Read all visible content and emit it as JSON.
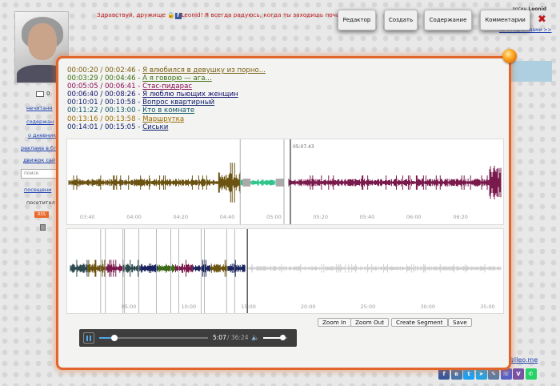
{
  "colors": {
    "accent": "#e1662b",
    "link": "#1a3fb0",
    "greeting": "#c01818"
  },
  "page": {
    "greeting_prefix": "Здравствуй, дружище",
    "greeting_user": "Leonid",
    "greeting_suffix": "! Я всегда радуюсь, когда ты заходишь почитать мо",
    "login_label": "логин",
    "login_user": "Leonid",
    "top_link": "ни с переходами >>",
    "sidebar": {
      "count": "0",
      "links": [
        "нечитанн",
        "содержан",
        "о дневник",
        "реклама в бл",
        "движок сай",
        "посещени"
      ],
      "search_placeholder": "поиск",
      "visitors_label": "посетител",
      "rss": "RSS"
    },
    "email": "o@lleo.me"
  },
  "toolbar": {
    "buttons": [
      "Редактор",
      "Создать",
      "Содержание",
      "Комментарии"
    ]
  },
  "modal": {
    "tracks": [
      {
        "start": "00:00:20",
        "end": "00:02:46",
        "title": "Я влюбился в девушку из порно...",
        "color": "#7a5d10"
      },
      {
        "start": "00:03:29",
        "end": "00:04:46",
        "title": "А я говорю — ага...",
        "color": "#3d7010"
      },
      {
        "start": "00:05:05",
        "end": "00:06:41",
        "title": "Стас-пидарас",
        "color": "#8a0f55"
      },
      {
        "start": "00:06:40",
        "end": "00:08:26",
        "title": "Я люблю пьющих женщин",
        "color": "#12106e"
      },
      {
        "start": "00:10:01",
        "end": "00:10:58",
        "title": "Вопрос квартирный",
        "color": "#0d1f6a"
      },
      {
        "start": "00:11:22",
        "end": "00:13:00",
        "title": "Кто в комнате",
        "color": "#0f5565"
      },
      {
        "start": "00:13:16",
        "end": "00:13:58",
        "title": "Маршрутка",
        "color": "#9a6d07"
      },
      {
        "start": "00:14:01",
        "end": "00:15:05",
        "title": "Сиськи",
        "color": "#0d1f6a"
      }
    ],
    "wave1": {
      "cursor_label": "05:07.43",
      "ticks": [
        "03:40",
        "04:00",
        "04:20",
        "04:40",
        "05:00",
        "05:20",
        "05:40",
        "06:00",
        "06:20"
      ]
    },
    "wave2": {
      "ticks": [
        "05:00",
        "10:00",
        "15:00",
        "20:00",
        "25:00",
        "30:00",
        "35:00"
      ]
    },
    "buttons": {
      "zoom_in": "Zoom In",
      "zoom_out": "Zoom Out",
      "create_segment": "Create Segment",
      "save": "Save"
    },
    "player": {
      "current": "5:07",
      "total": "/ 36:24",
      "progress": 0.14,
      "volume": 0.8
    }
  }
}
